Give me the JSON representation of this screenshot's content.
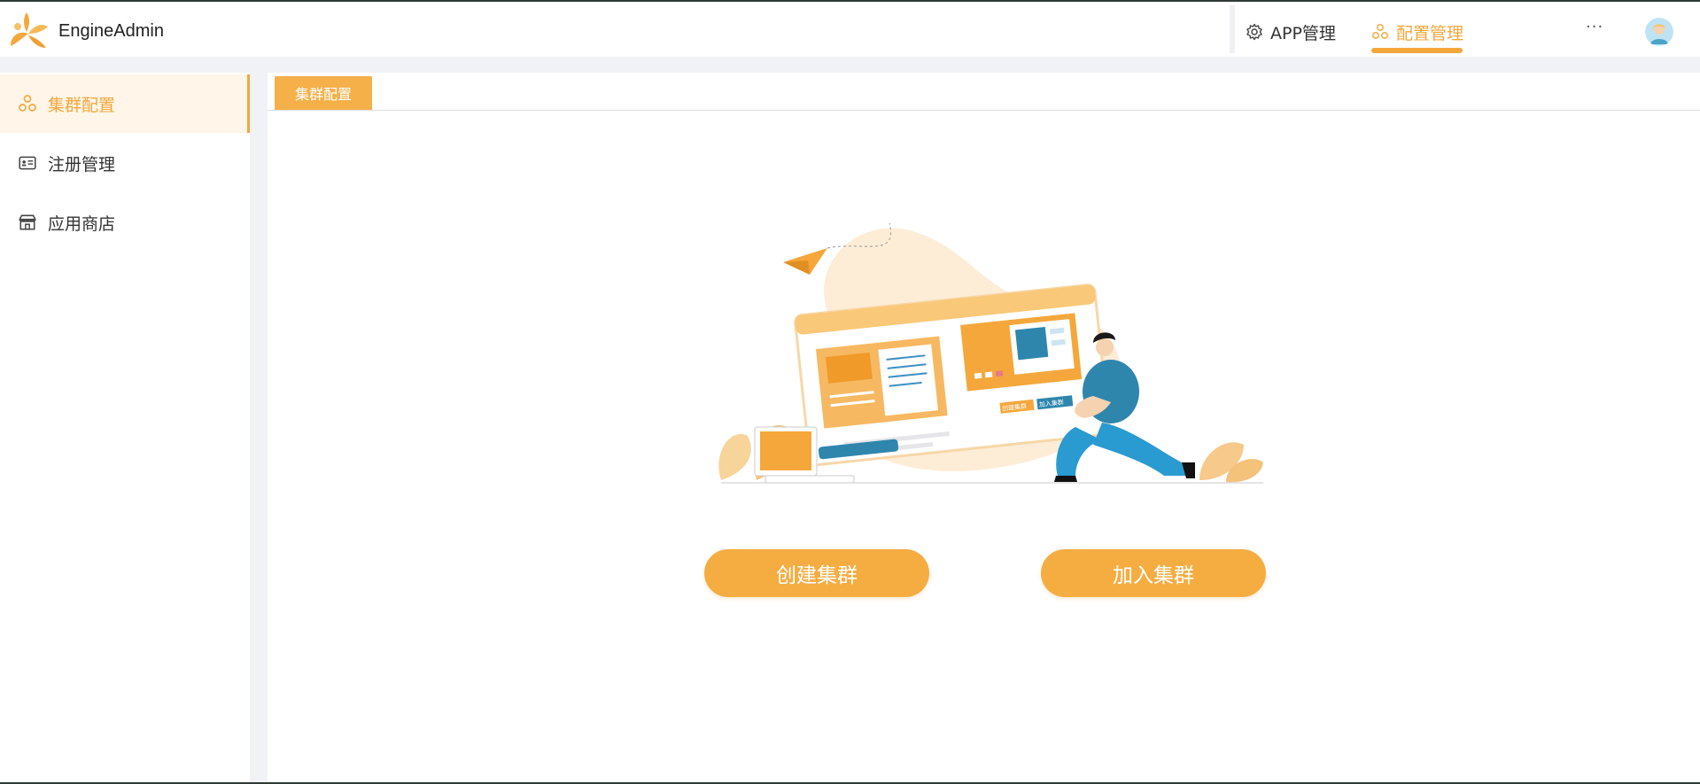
{
  "app": {
    "brand": "EngineAdmin"
  },
  "header": {
    "nav": [
      {
        "label": "APP管理",
        "icon": "gear-icon",
        "active": false
      },
      {
        "label": "配置管理",
        "icon": "cluster-icon",
        "active": true
      }
    ],
    "more_label": "···",
    "accent_color": "#f5a73c"
  },
  "sidebar": {
    "items": [
      {
        "label": "集群配置",
        "icon": "cluster-icon",
        "active": true
      },
      {
        "label": "注册管理",
        "icon": "id-card-icon",
        "active": false
      },
      {
        "label": "应用商店",
        "icon": "store-icon",
        "active": false
      }
    ]
  },
  "main": {
    "tabs": [
      {
        "label": "集群配置",
        "active": true
      }
    ],
    "illustration": {
      "create_label": "创建集群",
      "join_label": "加入集群"
    },
    "buttons": {
      "create_label": "创建集群",
      "join_label": "加入集群"
    }
  }
}
